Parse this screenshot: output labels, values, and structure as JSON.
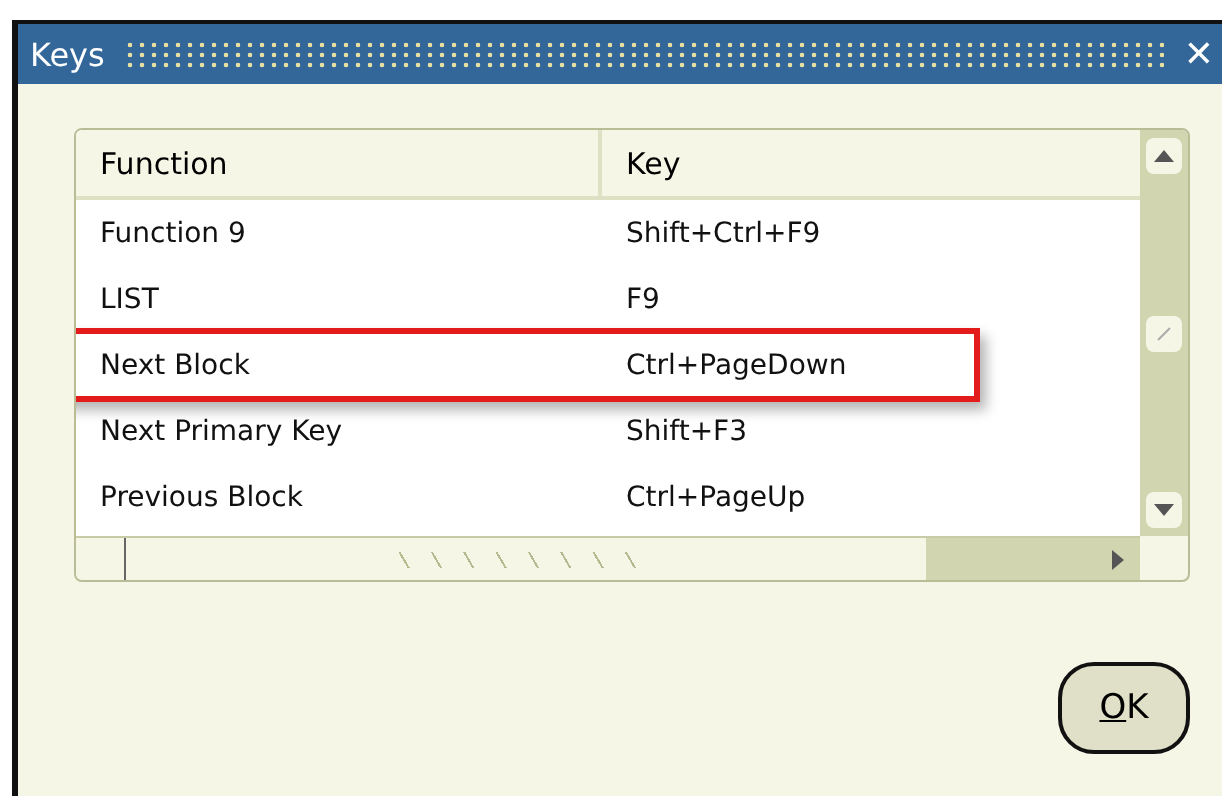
{
  "window": {
    "title": "Keys",
    "close": "✕"
  },
  "table": {
    "columns": [
      "Function",
      "Key"
    ],
    "rows": [
      {
        "cells": [
          "Function 9",
          "Shift+Ctrl+F9"
        ],
        "highlighted": false
      },
      {
        "cells": [
          "LIST",
          "F9"
        ],
        "highlighted": false
      },
      {
        "cells": [
          "Next Block",
          "Ctrl+PageDown"
        ],
        "highlighted": true
      },
      {
        "cells": [
          "Next Primary Key",
          "Shift+F3"
        ],
        "highlighted": false
      },
      {
        "cells": [
          "Previous Block",
          "Ctrl+PageUp"
        ],
        "highlighted": false
      }
    ]
  },
  "buttons": [
    {
      "label": "OK"
    }
  ]
}
